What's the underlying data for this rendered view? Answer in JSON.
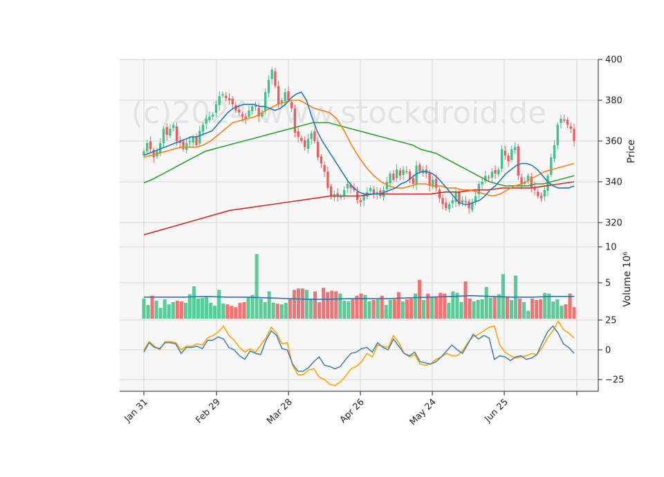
{
  "watermark": "(c)2024 www.stockdroid.de",
  "chart_data": [
    {
      "type": "candlestick",
      "ylabel": "Price",
      "ylim": [
        312,
        400
      ],
      "yticks": [
        320,
        340,
        360,
        380,
        400
      ],
      "xticks": [
        "Jan 31",
        "Feb 29",
        "Mar 28",
        "Apr 26",
        "May 24",
        "Jun 25"
      ],
      "colors": {
        "up": "#3cc386",
        "down": "#f25a5a",
        "ma_short": "#1f77b4",
        "ma_mid": "#ff7f0e",
        "ma_long": "#2ca02c",
        "ma_longest": "#d62728"
      },
      "close": [
        355,
        359,
        356,
        352,
        355,
        359,
        366,
        363,
        366,
        368,
        360,
        359,
        356,
        359,
        360,
        362,
        358,
        365,
        368,
        371,
        372,
        373,
        378,
        382,
        383,
        381,
        380,
        378,
        375,
        374,
        372,
        371,
        375,
        377,
        377,
        372,
        374,
        384,
        390,
        395,
        387,
        378,
        380,
        384,
        380,
        376,
        364,
        362,
        360,
        357,
        361,
        364,
        360,
        352,
        349,
        345,
        337,
        333,
        334,
        333,
        333,
        336,
        339,
        337,
        336,
        331,
        330,
        333,
        335,
        337,
        334,
        335,
        333,
        336,
        340,
        344,
        341,
        346,
        343,
        346,
        345,
        341,
        339,
        348,
        345,
        346,
        344,
        338,
        341,
        337,
        332,
        329,
        327,
        329,
        331,
        335,
        329,
        331,
        330,
        327,
        330,
        333,
        339,
        340,
        343,
        342,
        345,
        344,
        346,
        356,
        353,
        350,
        356,
        357,
        343,
        339,
        340,
        343,
        337,
        336,
        333,
        332,
        336,
        343,
        352,
        358,
        368,
        371,
        370,
        368,
        366,
        360
      ],
      "ma_short": [
        353,
        354,
        355,
        356,
        357,
        358,
        359,
        360,
        361,
        362,
        362,
        363,
        364,
        365,
        368,
        371,
        374,
        376,
        377,
        378,
        378,
        378,
        377,
        377,
        376,
        375,
        376,
        378,
        381,
        383,
        384,
        380,
        372,
        365,
        360,
        356,
        352,
        348,
        344,
        340,
        337,
        335,
        334,
        334,
        334,
        334,
        335,
        336,
        337,
        339,
        340,
        342,
        344,
        345,
        345,
        344,
        342,
        339,
        336,
        333,
        330,
        329,
        329,
        330,
        331,
        333,
        336,
        338,
        341,
        344,
        346,
        348,
        349,
        349,
        348,
        346,
        343,
        340,
        338,
        337,
        337,
        337,
        338
      ],
      "ma_mid": [
        352,
        353,
        354,
        355,
        356,
        357,
        357,
        357,
        358,
        360,
        363,
        366,
        369,
        370,
        371,
        372,
        374,
        376,
        378,
        379,
        380,
        380,
        378,
        376,
        375,
        374,
        371,
        365,
        358,
        352,
        347,
        343,
        340,
        338,
        337,
        337,
        338,
        339,
        339,
        338,
        338,
        337,
        337,
        336,
        336,
        335,
        334,
        333,
        334,
        336,
        338,
        339,
        341,
        343,
        345,
        346,
        347,
        348,
        349
      ],
      "ma_long": [
        339.5,
        341,
        343,
        345,
        347,
        349,
        351,
        353,
        355,
        356,
        357,
        358,
        359,
        360,
        361,
        362,
        363,
        364,
        365,
        366,
        367,
        368,
        369,
        369,
        369,
        368,
        367,
        366,
        365,
        364,
        363,
        362,
        361,
        360,
        359,
        358,
        356,
        355,
        354,
        352,
        350,
        348,
        346,
        344,
        342,
        340,
        339,
        338,
        338,
        338,
        338,
        339,
        339,
        340,
        341,
        342,
        343
      ],
      "ma_longest": [
        314,
        316,
        318,
        320,
        322,
        324,
        326,
        327,
        328,
        329,
        330,
        331,
        332,
        333,
        333,
        333,
        334,
        334,
        334,
        334,
        334,
        335,
        335,
        336,
        336,
        337,
        337,
        337,
        338,
        339,
        340
      ]
    },
    {
      "type": "bar",
      "ylabel": "Volume  10⁶",
      "ylim": [
        0,
        10
      ],
      "yticks": [
        5,
        10
      ],
      "values": [
        2.8,
        1.9,
        3.2,
        2.5,
        1.5,
        2.7,
        2.0,
        2.3,
        2.5,
        2.4,
        2.2,
        3.4,
        4.5,
        2.8,
        2.9,
        3.0,
        2.2,
        1.8,
        4.0,
        2.1,
        2.0,
        1.8,
        1.6,
        2.2,
        2.3,
        3.0,
        3.3,
        9.0,
        2.8,
        2.3,
        3.8,
        2.2,
        2.1,
        2.0,
        2.2,
        2.7,
        4.0,
        4.2,
        4.2,
        4.0,
        2.8,
        3.8,
        2.3,
        4.3,
        3.7,
        3.9,
        3.8,
        3.5,
        2.5,
        2.4,
        2.7,
        3.2,
        3.5,
        3.3,
        2.4,
        2.6,
        2.7,
        3.2,
        1.9,
        2.6,
        2.7,
        3.7,
        2.4,
        2.7,
        2.8,
        3.5,
        5.4,
        2.6,
        3.5,
        3.1,
        3.0,
        3.6,
        3.5,
        2.2,
        3.8,
        3.6,
        2.3,
        5.2,
        2.8,
        2.4,
        2.6,
        2.7,
        4.4,
        2.9,
        3.0,
        3.4,
        6.2,
        3.0,
        2.6,
        6.0,
        2.8,
        2.3,
        1.1,
        2.8,
        2.6,
        2.7,
        3.6,
        3.5,
        2.4,
        2.7,
        1.8,
        2.0,
        3.5,
        1.6
      ],
      "avg": [
        3.0,
        3.0,
        3.0,
        3.1,
        3.0,
        3.0,
        2.9,
        2.8,
        2.7,
        2.7,
        2.8,
        2.8,
        2.8,
        2.9,
        3.0,
        3.1,
        3.2,
        3.1,
        3.0,
        3.0,
        3.1,
        3.1
      ]
    },
    {
      "type": "line",
      "ylim": [
        -33,
        27
      ],
      "yticks": [
        25,
        0,
        -25
      ],
      "colors": {
        "line1": "#4682b4",
        "line2": "#ffa500"
      },
      "line1": [
        -2,
        6,
        2,
        1,
        6,
        6,
        5,
        -3,
        2,
        2,
        3,
        1,
        8,
        8,
        11,
        9,
        2,
        0,
        -5,
        -8,
        -1,
        -3,
        -4,
        8,
        16,
        12,
        1,
        0,
        -12,
        -18,
        -18,
        -15,
        -10,
        -6,
        -13,
        -14,
        -16,
        -14,
        -8,
        -3,
        -2,
        1,
        2,
        -2,
        6,
        2,
        0,
        9,
        3,
        -3,
        -5,
        -2,
        -10,
        -11,
        -12,
        -10,
        -6,
        -1,
        4,
        0,
        -3,
        5,
        13,
        9,
        12,
        10,
        -8,
        -5,
        -6,
        -9,
        -6,
        -5,
        -8,
        -7,
        -4,
        6,
        15,
        20,
        14,
        5,
        2,
        -3
      ],
      "line2": [
        0,
        7,
        3,
        0,
        7,
        7,
        6,
        0,
        3,
        3,
        5,
        4,
        10,
        12,
        15,
        20,
        12,
        8,
        2,
        -2,
        1,
        -2,
        4,
        10,
        19,
        14,
        5,
        6,
        -13,
        -21,
        -21,
        -17,
        -16,
        -23,
        -25,
        -29,
        -30,
        -27,
        -22,
        -16,
        -14,
        -10,
        -3,
        -6,
        4,
        3,
        2,
        12,
        6,
        -3,
        -6,
        -4,
        -12,
        -13,
        -12,
        -8,
        -6,
        -3,
        -5,
        -5,
        -1,
        6,
        11,
        13,
        16,
        19,
        20,
        4,
        -2,
        -5,
        -7,
        -6,
        -5,
        -3,
        -4,
        2,
        10,
        16,
        24,
        17,
        14,
        10
      ]
    }
  ]
}
